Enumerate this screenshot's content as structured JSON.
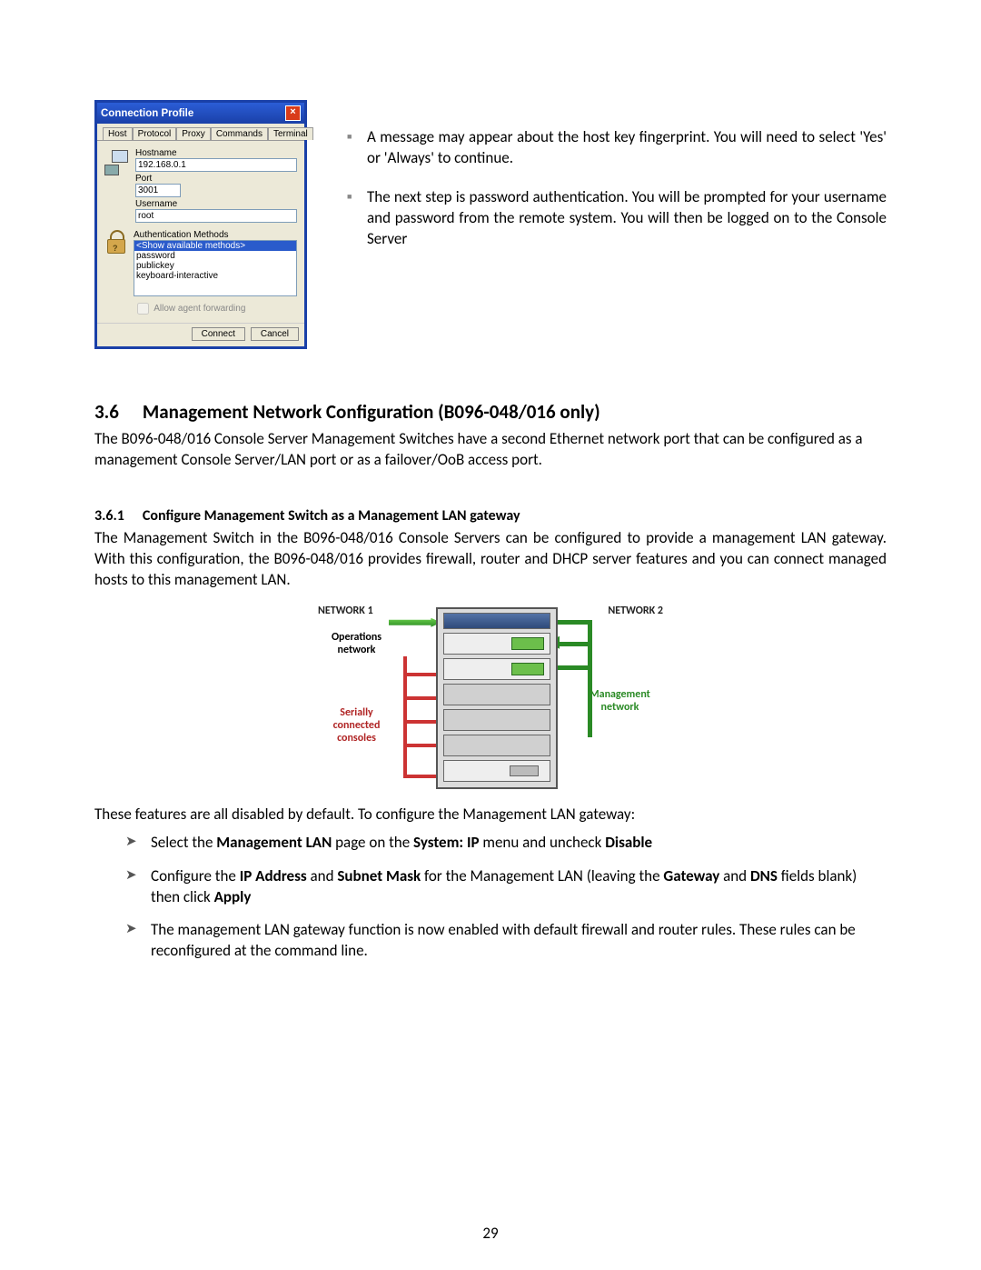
{
  "dialog": {
    "title": "Connection Profile",
    "tabs": [
      "Host",
      "Protocol",
      "Proxy",
      "Commands",
      "Terminal"
    ],
    "labels": {
      "hostname": "Hostname",
      "port": "Port",
      "username": "Username",
      "auth_methods": "Authentication Methods",
      "agent_fwd": "Allow agent forwarding"
    },
    "values": {
      "hostname": "192.168.0.1",
      "port": "3001",
      "username": "root"
    },
    "auth_options": [
      "<Show available methods>",
      "password",
      "publickey",
      "keyboard-interactive"
    ],
    "buttons": {
      "connect": "Connect",
      "cancel": "Cancel"
    }
  },
  "right_bullets": [
    "A message may appear about the host key fingerprint. You will need to select 'Yes' or 'Always' to continue.",
    "The next step is password authentication. You will be prompted for your username and password from the remote system. You will then be logged on to the Console Server"
  ],
  "section36": {
    "num": "3.6",
    "title": "Management Network Configuration (B096-048/016 only)",
    "p1": "The B096-048/016 Console Server Management Switches have a second Ethernet network port that can be configured as a management Console Server/LAN port or as a failover/OoB access port."
  },
  "section361": {
    "num": "3.6.1",
    "title": "Configure Management Switch as a Management LAN gateway",
    "p1": "The Management Switch in the B096-048/016 Console Servers can be configured to provide a management LAN gateway. With this configuration, the B096-048/016 provides firewall, router and DHCP server features and you can connect managed hosts to this management LAN."
  },
  "diagram_labels": {
    "n1": "NETWORK 1",
    "n2": "NETWORK 2",
    "ops": "Operations network",
    "mgmt": "Management network",
    "ser": "Serially connected consoles"
  },
  "post_diagram": "These features are all disabled by default. To configure the Management LAN gateway:",
  "steps": [
    {
      "pre": "Select the ",
      "b1": "Management LAN",
      "mid1": " page on the ",
      "b2": "System: IP",
      "mid2": " menu and uncheck ",
      "b3": "Disable",
      "post": ""
    },
    {
      "pre": "Configure the ",
      "b1": "IP Address",
      "mid1": " and ",
      "b2": "Subnet Mask",
      "mid2": " for the Management LAN (leaving the ",
      "b3": "Gateway",
      "mid3": " and ",
      "b4": "DNS",
      "mid4": " fields blank) then click ",
      "b5": "Apply",
      "post": ""
    },
    {
      "plain": "The management LAN gateway function is now enabled with default firewall and router rules. These rules can be reconfigured at the command line."
    }
  ],
  "page_number": "29"
}
